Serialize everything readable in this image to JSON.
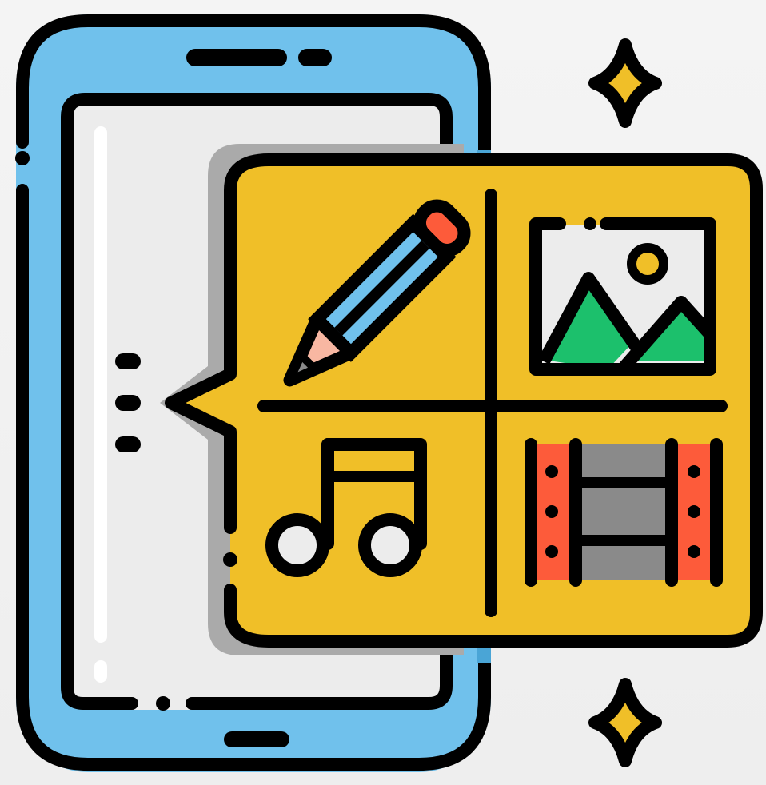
{
  "colors": {
    "outline": "#000000",
    "phone_body": "#70c1ec",
    "phone_shadow": "#4aa5d6",
    "screen": "#ececec",
    "screen_highlight": "#ffffff",
    "bubble": "#f0bf28",
    "bubble_shadow": "#aaaaaa",
    "pencil_body": "#70c1ec",
    "pencil_eraser": "#fd5b3a",
    "pencil_tip": "#f8b7a2",
    "pencil_lead": "#8a8a8a",
    "picture_bg": "#ececec",
    "mountains": "#1cc06c",
    "sun": "#f0bf28",
    "note_heads": "#ececec",
    "film_strip": "#fd5b3a",
    "film_frame": "#8a8a8a",
    "sparkle": "#f0bf28"
  },
  "icons": {
    "phone": "smartphone-icon",
    "bubble": "speech-bubble-icon",
    "tiles": [
      "pencil-icon",
      "image-icon",
      "music-note-icon",
      "film-strip-icon"
    ],
    "sparkles": [
      "sparkle-icon",
      "sparkle-icon"
    ],
    "dots": "ellipsis-icon"
  }
}
